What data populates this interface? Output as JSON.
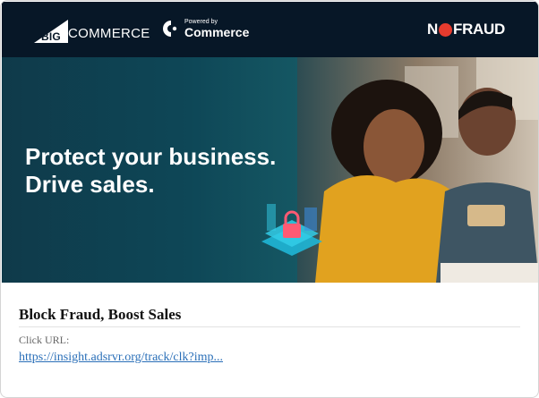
{
  "banner": {
    "brand_logo_text": "BIGCOMMERCE",
    "powered_small": "Powered by",
    "powered_large": "Commerce",
    "partner_logo_text": "NOFRAUD",
    "headline_line1": "Protect your business.",
    "headline_line2": "Drive sales.",
    "colors": {
      "topbar": "#071727",
      "accent_red": "#e63b2e"
    }
  },
  "ad": {
    "title": "Block Fraud, Boost Sales",
    "click_url_label": "Click URL:",
    "click_url": "https://insight.adsrvr.org/track/clk?imp..."
  },
  "icons": [
    "bigcommerce-logo-icon",
    "commerce-logo-icon",
    "nofraud-logo-icon",
    "security-lock-icon"
  ]
}
